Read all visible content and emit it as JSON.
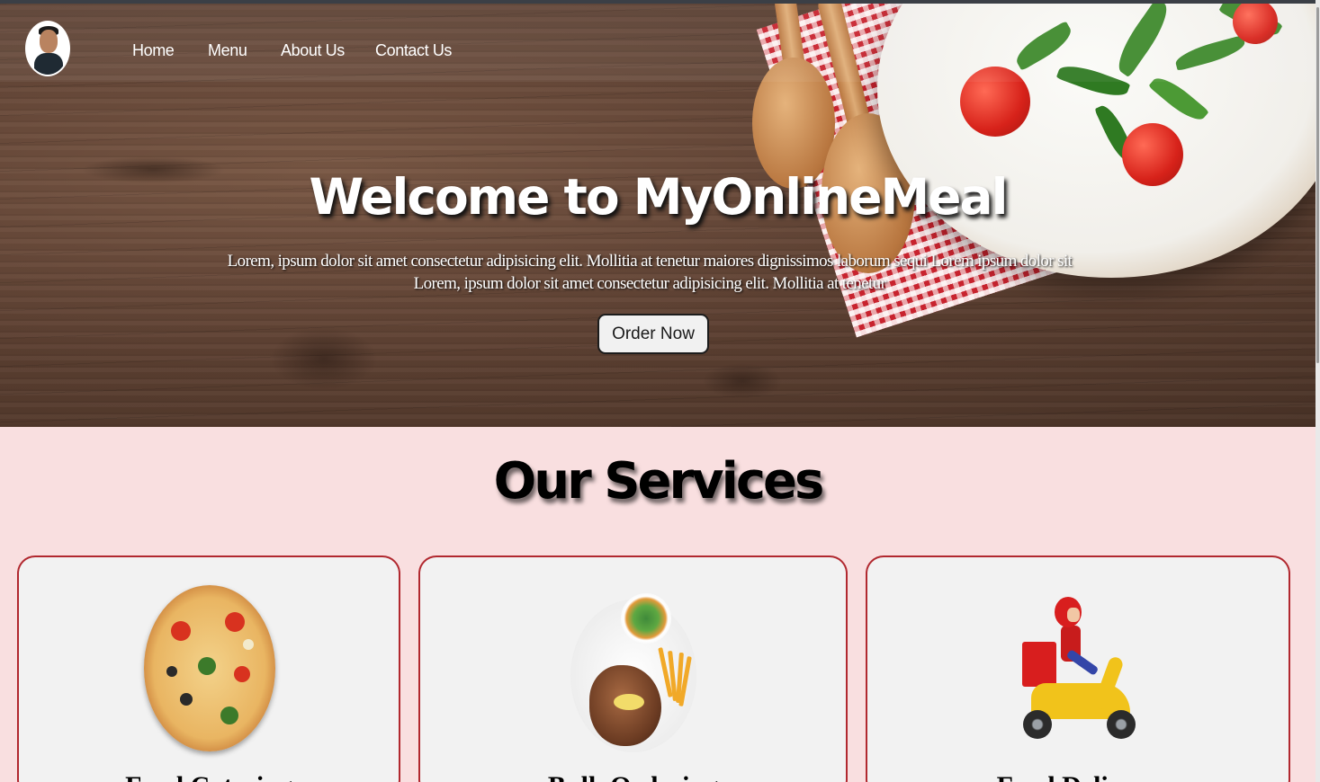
{
  "nav": {
    "avatar_name": "avatar",
    "links": [
      "Home",
      "Menu",
      "About Us",
      "Contact Us"
    ]
  },
  "hero": {
    "title": "Welcome to MyOnlineMeal",
    "subtitle": "Lorem, ipsum dolor sit amet consectetur adipisicing elit. Mollitia at tenetur maiores dignissimos laborum sequi Lorem ipsum dolor sit Lorem, ipsum dolor sit amet consectetur adipisicing elit. Mollitia at tenetur",
    "cta_label": "Order Now"
  },
  "services": {
    "title": "Our Services",
    "cards": [
      {
        "title": "Food Catering",
        "icon": "pizza-image"
      },
      {
        "title": "Bulk Ordering",
        "icon": "steak-plate-image"
      },
      {
        "title": "Food Delivery",
        "icon": "delivery-scooter-image"
      }
    ]
  },
  "colors": {
    "page_background": "#f9dfe0",
    "card_border": "#b1282f",
    "card_background": "#f2f2f2",
    "hero_wood": "#5b3f31"
  }
}
